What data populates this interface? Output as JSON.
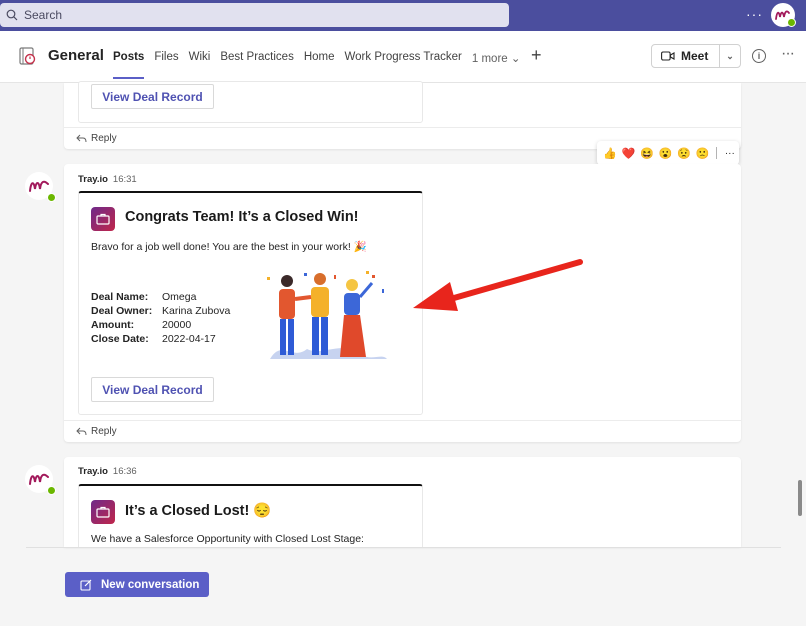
{
  "topbar": {
    "search_placeholder": "Search",
    "more_label": "···"
  },
  "header": {
    "title": "General",
    "tabs": [
      {
        "label": "Posts"
      },
      {
        "label": "Files"
      },
      {
        "label": "Wiki"
      },
      {
        "label": "Best Practices"
      },
      {
        "label": "Home"
      },
      {
        "label": "Work Progress Tracker"
      },
      {
        "label": "1 more ⌄"
      }
    ],
    "add_tab_label": "+",
    "meet_label": "Meet",
    "meet_caret": "⌄",
    "info_label": "i",
    "more_label": "···"
  },
  "reactions": [
    "👍",
    "❤️",
    "😆",
    "😮",
    "😟",
    "🙁"
  ],
  "reactions_more": "···",
  "messages": [
    {
      "view_button": "View Deal Record",
      "reply_label": "Reply"
    },
    {
      "sender": "Tray.io",
      "time": "16:31",
      "card_title": "Congrats Team! It’s a Closed Win!",
      "body": "Bravo for a job well done! You are the best in your work! 🎉",
      "facts": [
        {
          "key": "Deal Name:",
          "value": "Omega"
        },
        {
          "key": "Deal Owner:",
          "value": "Karina Zubova"
        },
        {
          "key": "Amount:",
          "value": "20000"
        },
        {
          "key": "Close Date:",
          "value": "2022-04-17"
        }
      ],
      "view_button": "View Deal Record",
      "reply_label": "Reply"
    },
    {
      "sender": "Tray.io",
      "time": "16:36",
      "card_title": "It’s a Closed Lost! 😔",
      "body": "We have a Salesforce Opportunity with Closed Lost Stage:"
    }
  ],
  "compose": {
    "new_conversation": "New conversation"
  },
  "colors": {
    "accent": "#5b5fc7",
    "topbar": "#4b4e9e",
    "arrow": "#e8251c"
  }
}
